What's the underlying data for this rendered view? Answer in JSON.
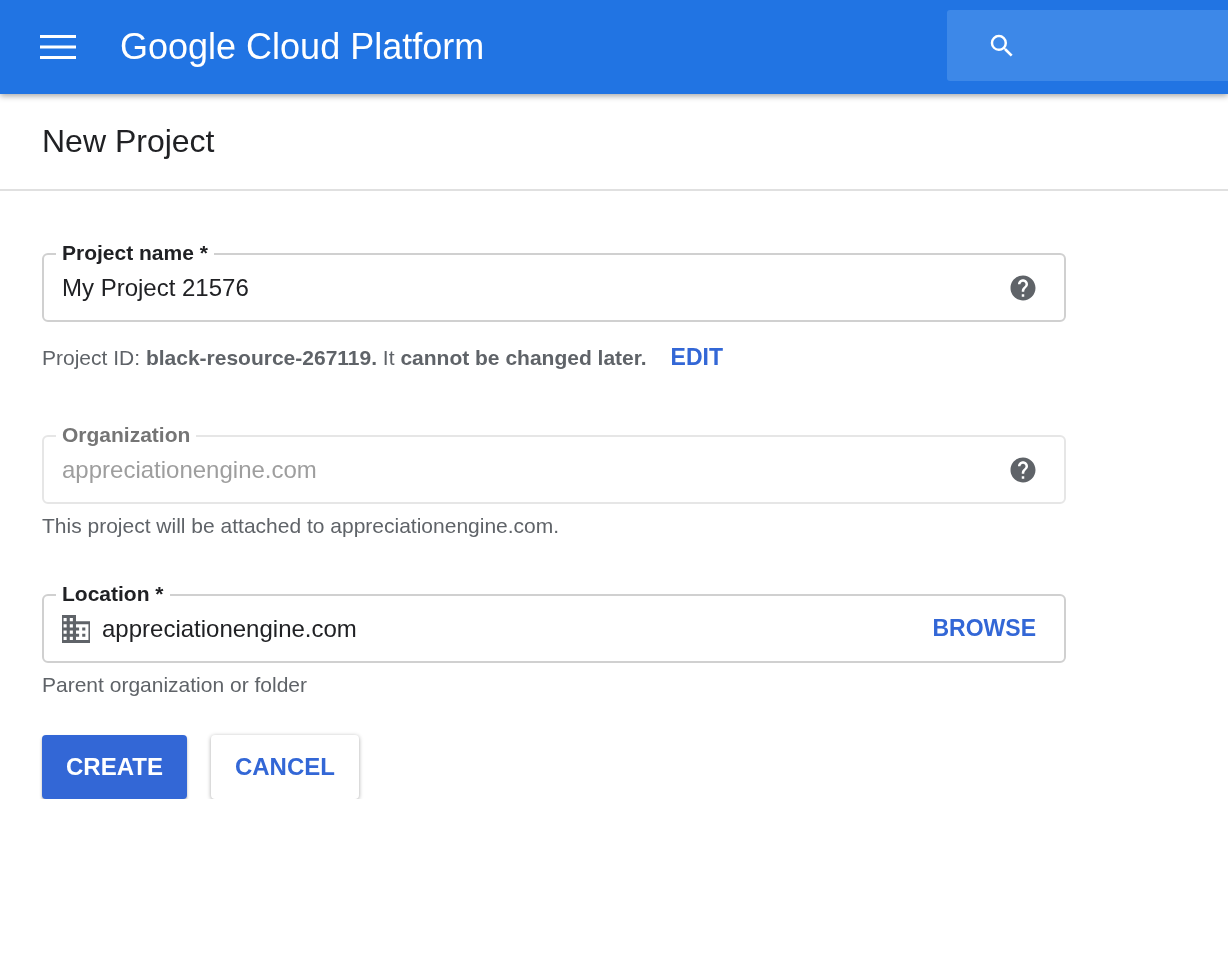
{
  "header": {
    "title": "Google Cloud Platform"
  },
  "page_title": "New Project",
  "fields": [
    {
      "kind": "help",
      "label": "Project name *",
      "value": "My Project 21576",
      "disabled": false,
      "helper": "Project ID: **black-resource-267119.** It **cannot be changed later.**",
      "helper_link": "EDIT"
    },
    {
      "kind": "help",
      "label": "Organization",
      "value": "appreciationengine.com",
      "disabled": true,
      "helper": "This project will be attached to appreciationengine.com."
    },
    {
      "kind": "location",
      "label": "Location *",
      "value": "appreciationengine.com",
      "disabled": false,
      "action": "BROWSE",
      "helper": "Parent organization or folder"
    }
  ],
  "buttons": [
    {
      "label": "CREATE",
      "kind": "primary"
    },
    {
      "label": "CANCEL",
      "kind": "secondary"
    }
  ]
}
